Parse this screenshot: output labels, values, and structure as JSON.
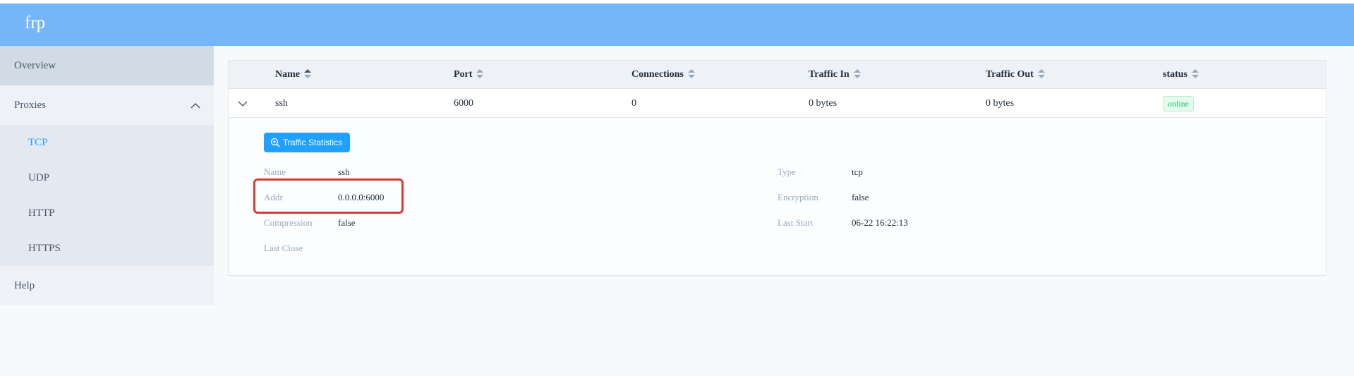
{
  "app": {
    "logo": "frp"
  },
  "sidebar": {
    "overview": "Overview",
    "proxies": "Proxies",
    "proxy_types": [
      "TCP",
      "UDP",
      "HTTP",
      "HTTPS"
    ],
    "active_type": "TCP",
    "help": "Help"
  },
  "table": {
    "columns": [
      "Name",
      "Port",
      "Connections",
      "Traffic In",
      "Traffic Out",
      "status"
    ],
    "rows": [
      {
        "name": "ssh",
        "port": "6000",
        "connections": "0",
        "traffic_in": "0 bytes",
        "traffic_out": "0 bytes",
        "status": "online"
      }
    ]
  },
  "detail": {
    "traffic_button": "Traffic Statistics",
    "fields": {
      "name_label": "Name",
      "name_value": "ssh",
      "type_label": "Type",
      "type_value": "tcp",
      "addr_label": "Addr",
      "addr_value": "0.0.0.0:6000",
      "encryption_label": "Encryption",
      "encryption_value": "false",
      "compression_label": "Compression",
      "compression_value": "false",
      "last_start_label": "Last Start",
      "last_start_value": "06-22 16:22:13",
      "last_close_label": "Last Close",
      "last_close_value": ""
    }
  },
  "colors": {
    "header_bg": "#74b6f8",
    "accent": "#20a0ff",
    "status_online": "#13ce66",
    "highlight": "#d63a34"
  },
  "icons": [
    "chevron-up-icon",
    "chevron-down-icon",
    "sort-caret-icon",
    "zoom-in-icon"
  ]
}
